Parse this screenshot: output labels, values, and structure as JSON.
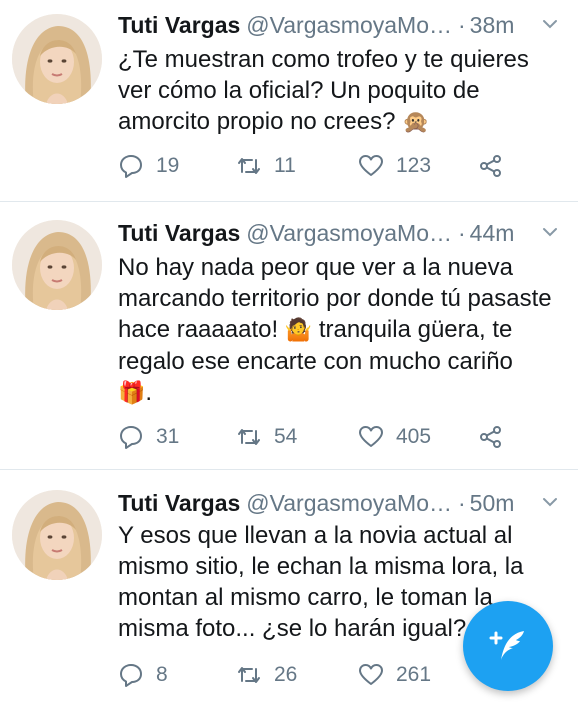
{
  "colors": {
    "accent": "#1da1f2",
    "text_primary": "#14171a",
    "text_secondary": "#657786",
    "divider": "#e1e8ed"
  },
  "tweets": [
    {
      "author": {
        "name": "Tuti Vargas",
        "handle": "@VargasmoyaMo…"
      },
      "separator": "·",
      "time": "38m",
      "text_lines": [
        "¿Te muestran como trofeo y te quieres",
        "ver cómo la oficial? Un poquito de",
        "amorcito propio no crees?"
      ],
      "emoji": "🙊",
      "replies": "19",
      "retweets": "11",
      "likes": "123"
    },
    {
      "author": {
        "name": "Tuti Vargas",
        "handle": "@VargasmoyaMo…"
      },
      "separator": "·",
      "time": "44m",
      "text_lines": [
        "No hay nada peor que ver a la nueva",
        "marcando territorio por donde tú pasaste",
        "hace raaaaato!",
        "tranquila güera, te",
        "regalo ese encarte con mucho cariño",
        "."
      ],
      "emoji_shrug": "🤷",
      "emoji_gift": "🎁",
      "replies": "31",
      "retweets": "54",
      "likes": "405"
    },
    {
      "author": {
        "name": "Tuti Vargas",
        "handle": "@VargasmoyaMo…"
      },
      "separator": "·",
      "time": "50m",
      "text_lines": [
        "Y esos que llevan a la novia actual al",
        "mismo sitio, le echan la misma lora, la",
        "montan al mismo carro, le toman la",
        "misma foto... ¿se lo harán igual?"
      ],
      "replies": "8",
      "retweets": "26",
      "likes": "261"
    }
  ],
  "icons": {
    "reply": "reply-icon",
    "retweet": "retweet-icon",
    "like": "heart-icon",
    "share": "share-icon",
    "more": "chevron-down-icon",
    "compose": "compose-tweet-icon"
  }
}
